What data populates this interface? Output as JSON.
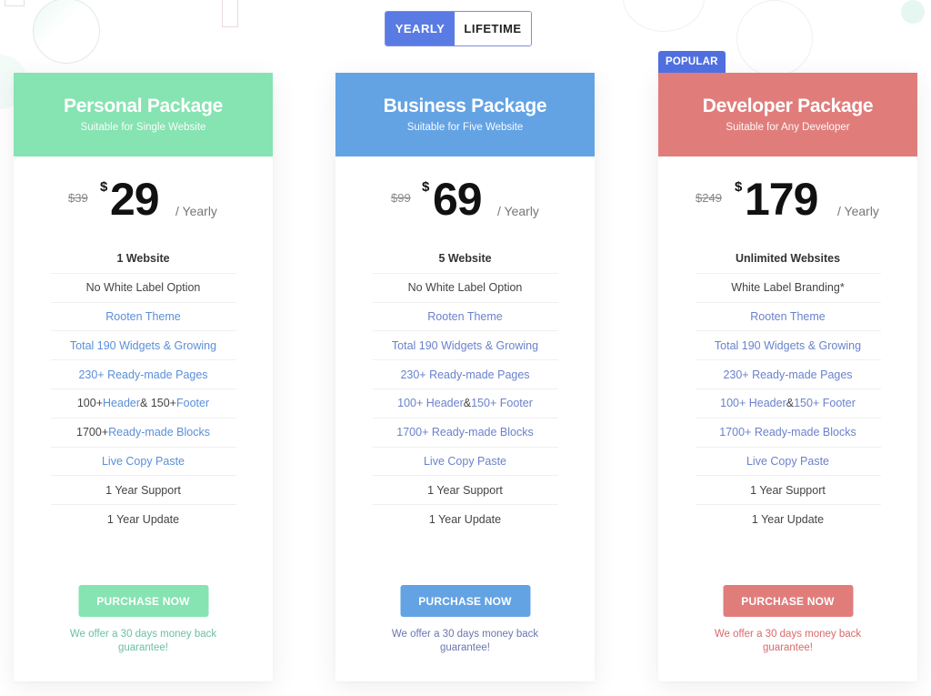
{
  "billing_toggle": {
    "options": [
      {
        "label": "YEARLY",
        "active": true
      },
      {
        "label": "LIFETIME",
        "active": false
      }
    ],
    "active_color": "#5a7be3"
  },
  "plans": [
    {
      "id": "personal",
      "title": "Personal Package",
      "subtitle": "Suitable for Single Website",
      "color": "#86e3b2",
      "guarantee_color": "#6cc0a0",
      "badge": null,
      "old_price": "$39",
      "currency": "$",
      "price": "29",
      "period": "/ Yearly",
      "features": [
        {
          "parts": [
            {
              "text": "1 Website",
              "highlight": false
            }
          ],
          "bold": true
        },
        {
          "parts": [
            {
              "text": "No White Label Option",
              "highlight": false
            }
          ],
          "bold": false
        },
        {
          "parts": [
            {
              "text": "Rooten Theme",
              "highlight": true
            }
          ],
          "bold": false
        },
        {
          "parts": [
            {
              "text": "Total 190 Widgets & Growing",
              "highlight": true
            }
          ],
          "bold": false
        },
        {
          "parts": [
            {
              "text": "230+ Ready-made Pages",
              "highlight": true
            }
          ],
          "bold": false
        },
        {
          "parts": [
            {
              "text": "100+ ",
              "highlight": false
            },
            {
              "text": "Header",
              "highlight": true
            },
            {
              "text": " & 150+ ",
              "highlight": false
            },
            {
              "text": "Footer",
              "highlight": true
            }
          ],
          "bold": false
        },
        {
          "parts": [
            {
              "text": "1700+ ",
              "highlight": false
            },
            {
              "text": "Ready-made Blocks",
              "highlight": true
            }
          ],
          "bold": false
        },
        {
          "parts": [
            {
              "text": "Live Copy Paste",
              "highlight": true
            }
          ],
          "bold": false
        },
        {
          "parts": [
            {
              "text": "1 Year Support",
              "highlight": false
            }
          ],
          "bold": false
        },
        {
          "parts": [
            {
              "text": "1 Year Update",
              "highlight": false
            }
          ],
          "bold": false
        }
      ],
      "button_label": "PURCHASE NOW",
      "guarantee": "We offer a 30 days money back guarantee!"
    },
    {
      "id": "business",
      "title": "Business Package",
      "subtitle": "Suitable for Five Website",
      "color": "#63a3e4",
      "guarantee_color": "#6a76b0",
      "badge": null,
      "old_price": "$99",
      "currency": "$",
      "price": "69",
      "period": "/ Yearly",
      "features": [
        {
          "parts": [
            {
              "text": "5 Website",
              "highlight": false
            }
          ],
          "bold": true
        },
        {
          "parts": [
            {
              "text": "No White Label Option",
              "highlight": false
            }
          ],
          "bold": false
        },
        {
          "parts": [
            {
              "text": "Rooten Theme",
              "highlight": true
            }
          ],
          "bold": false
        },
        {
          "parts": [
            {
              "text": "Total 190 Widgets & Growing",
              "highlight": true
            }
          ],
          "bold": false
        },
        {
          "parts": [
            {
              "text": "230+ Ready-made Pages",
              "highlight": true
            }
          ],
          "bold": false
        },
        {
          "parts": [
            {
              "text": "100+ Header",
              "highlight": true
            },
            {
              "text": " & ",
              "highlight": false
            },
            {
              "text": "150+ Footer",
              "highlight": true
            }
          ],
          "bold": false
        },
        {
          "parts": [
            {
              "text": "1700+ Ready-made Blocks",
              "highlight": true
            }
          ],
          "bold": false
        },
        {
          "parts": [
            {
              "text": "Live Copy Paste",
              "highlight": true
            }
          ],
          "bold": false
        },
        {
          "parts": [
            {
              "text": "1 Year Support",
              "highlight": false
            }
          ],
          "bold": false
        },
        {
          "parts": [
            {
              "text": "1 Year Update",
              "highlight": false
            }
          ],
          "bold": false
        }
      ],
      "button_label": "PURCHASE NOW",
      "guarantee": "We offer a 30 days money back guarantee!"
    },
    {
      "id": "developer",
      "title": "Developer Package",
      "subtitle": "Suitable for Any Developer",
      "color": "#e07d7b",
      "guarantee_color": "#d86a6a",
      "badge": "POPULAR",
      "old_price": "$249",
      "currency": "$",
      "price": "179",
      "period": "/ Yearly",
      "features": [
        {
          "parts": [
            {
              "text": "Unlimited Websites",
              "highlight": false
            }
          ],
          "bold": true
        },
        {
          "parts": [
            {
              "text": "White Label Branding*",
              "highlight": false
            }
          ],
          "bold": false
        },
        {
          "parts": [
            {
              "text": "Rooten Theme",
              "highlight": true
            }
          ],
          "bold": false
        },
        {
          "parts": [
            {
              "text": "Total 190 Widgets & Growing",
              "highlight": true
            }
          ],
          "bold": false
        },
        {
          "parts": [
            {
              "text": "230+ Ready-made Pages",
              "highlight": true
            }
          ],
          "bold": false
        },
        {
          "parts": [
            {
              "text": "100+ Header",
              "highlight": true
            },
            {
              "text": " & ",
              "highlight": false
            },
            {
              "text": "150+ Footer",
              "highlight": true
            }
          ],
          "bold": false
        },
        {
          "parts": [
            {
              "text": "1700+ Ready-made Blocks",
              "highlight": true
            }
          ],
          "bold": false
        },
        {
          "parts": [
            {
              "text": "Live Copy Paste",
              "highlight": true
            }
          ],
          "bold": false
        },
        {
          "parts": [
            {
              "text": "1 Year Support",
              "highlight": false
            }
          ],
          "bold": false
        },
        {
          "parts": [
            {
              "text": "1 Year Update",
              "highlight": false
            }
          ],
          "bold": false
        }
      ],
      "button_label": "PURCHASE NOW",
      "guarantee": "We offer a 30 days money back guarantee!"
    }
  ]
}
